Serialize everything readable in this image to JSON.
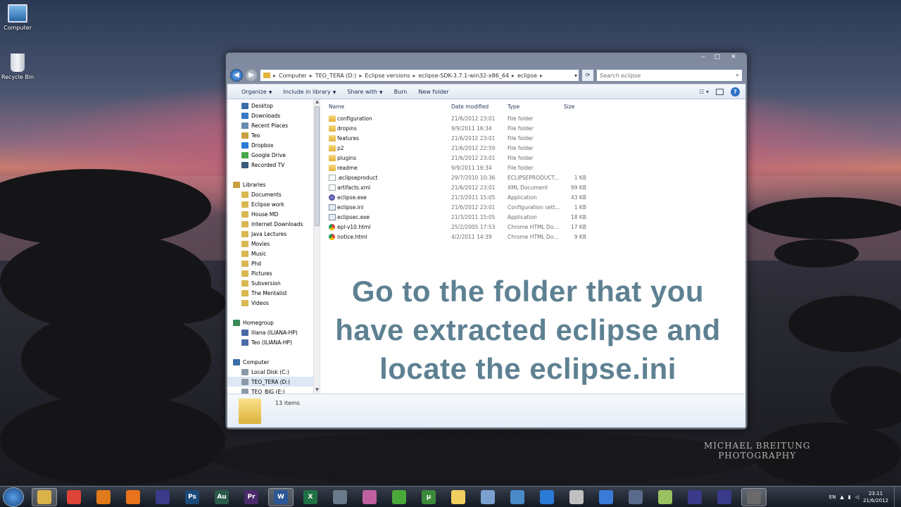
{
  "desktop": {
    "icons": [
      {
        "label": "Computer"
      },
      {
        "label": "Recycle Bin"
      }
    ],
    "watermark": [
      "MICHAEL BREITUNG",
      "PHOTOGRAPHY"
    ]
  },
  "window": {
    "address": {
      "crumbs": [
        "Computer",
        "TEO_TERA (D:)",
        "Eclipse versions",
        "eclipse-SDK-3.7.1-win32-x86_64",
        "eclipse"
      ]
    },
    "search": {
      "placeholder": "Search eclipse"
    },
    "toolbar": {
      "organize": "Organize",
      "include_in_library": "Include in library",
      "share_with": "Share with",
      "burn": "Burn",
      "new_folder": "New folder"
    },
    "nav": {
      "favorites": [
        "Desktop",
        "Downloads",
        "Recent Places",
        "Teo",
        "Dropbox",
        "Google Drive",
        "Recorded TV"
      ],
      "libraries_label": "Libraries",
      "libraries": [
        "Documents",
        "Eclipse work",
        "House MD",
        "Internet Downloads",
        "Java Lectures",
        "Movies",
        "Music",
        "Phd",
        "Pictures",
        "Subversion",
        "The Mentalist",
        "Videos"
      ],
      "homegroup_label": "Homegroup",
      "homegroup": [
        "Iliana (ILIANA-HP)",
        "Teo (ILIANA-HP)"
      ],
      "computer_label": "Computer",
      "drives": [
        "Local Disk (C:)",
        "TEO_TERA (D:)",
        "TEO_BIG (E:)"
      ]
    },
    "columns": {
      "name": "Name",
      "date": "Date modified",
      "type": "Type",
      "size": "Size"
    },
    "files": [
      {
        "name": "configuration",
        "date": "21/6/2012 23:01",
        "type": "File folder",
        "size": "",
        "icon": "folder"
      },
      {
        "name": "dropins",
        "date": "9/9/2011 16:34",
        "type": "File folder",
        "size": "",
        "icon": "folder"
      },
      {
        "name": "features",
        "date": "21/6/2012 23:01",
        "type": "File folder",
        "size": "",
        "icon": "folder"
      },
      {
        "name": "p2",
        "date": "21/6/2012 22:59",
        "type": "File folder",
        "size": "",
        "icon": "folder"
      },
      {
        "name": "plugins",
        "date": "21/6/2012 23:01",
        "type": "File folder",
        "size": "",
        "icon": "folder"
      },
      {
        "name": "readme",
        "date": "9/9/2011 16:34",
        "type": "File folder",
        "size": "",
        "icon": "folder"
      },
      {
        "name": ".eclipseproduct",
        "date": "29/7/2010 10:36",
        "type": "ECLIPSEPRODUCT...",
        "size": "1 KB",
        "icon": "doc"
      },
      {
        "name": "artifacts.xml",
        "date": "21/6/2012 23:01",
        "type": "XML Document",
        "size": "99 KB",
        "icon": "doc"
      },
      {
        "name": "eclipse.exe",
        "date": "21/3/2011 15:05",
        "type": "Application",
        "size": "43 KB",
        "icon": "exe"
      },
      {
        "name": "eclipse.ini",
        "date": "21/6/2012 23:01",
        "type": "Configuration sett...",
        "size": "1 KB",
        "icon": "ini"
      },
      {
        "name": "eclipsec.exe",
        "date": "21/3/2011 15:05",
        "type": "Application",
        "size": "18 KB",
        "icon": "ini"
      },
      {
        "name": "epl-v10.html",
        "date": "25/2/2005 17:53",
        "type": "Chrome HTML Do...",
        "size": "17 KB",
        "icon": "chrome"
      },
      {
        "name": "notice.html",
        "date": "4/2/2011 14:39",
        "type": "Chrome HTML Do...",
        "size": "9 KB",
        "icon": "chrome"
      }
    ],
    "status": {
      "count": "13 items"
    }
  },
  "caption": [
    "Go to the folder that you",
    "have extracted eclipse and",
    "locate the eclipse.ini"
  ],
  "taskbar": {
    "apps": [
      {
        "name": "explorer",
        "label": "",
        "color": "#d9b24a"
      },
      {
        "name": "chrome",
        "label": "",
        "color": "#db4437"
      },
      {
        "name": "media-player",
        "label": "",
        "color": "#e07a1a"
      },
      {
        "name": "firefox",
        "label": "",
        "color": "#e8731c"
      },
      {
        "name": "eclipse",
        "label": "",
        "color": "#3a3a8a"
      },
      {
        "name": "photoshop",
        "label": "Ps",
        "color": "#1b4a7a"
      },
      {
        "name": "audition",
        "label": "Au",
        "color": "#2a5a4a"
      },
      {
        "name": "premiere",
        "label": "Pr",
        "color": "#4a2a6a"
      },
      {
        "name": "word",
        "label": "W",
        "color": "#2b5797"
      },
      {
        "name": "excel",
        "label": "X",
        "color": "#1e7145"
      },
      {
        "name": "tool",
        "label": "",
        "color": "#6a7a8a"
      },
      {
        "name": "paint",
        "label": "",
        "color": "#c060a0"
      },
      {
        "name": "xbox",
        "label": "",
        "color": "#4aa83a"
      },
      {
        "name": "utorrent",
        "label": "µ",
        "color": "#3a8a3a"
      },
      {
        "name": "folder",
        "label": "",
        "color": "#f0d060"
      },
      {
        "name": "virtualbox",
        "label": "",
        "color": "#7aa0d0"
      },
      {
        "name": "screen",
        "label": "",
        "color": "#4a8ac8"
      },
      {
        "name": "dropbox",
        "label": "",
        "color": "#2a7ad8"
      },
      {
        "name": "chrome-2",
        "label": "",
        "color": "#c0c0c0"
      },
      {
        "name": "itunes",
        "label": "",
        "color": "#3a7ad8"
      },
      {
        "name": "network",
        "label": "",
        "color": "#5a6a8a"
      },
      {
        "name": "notes",
        "label": "",
        "color": "#9ac060"
      },
      {
        "name": "eclipse-2",
        "label": "",
        "color": "#3a3a8a"
      },
      {
        "name": "eclipse-3",
        "label": "",
        "color": "#3a3a8a"
      },
      {
        "name": "cmd",
        "label": "",
        "color": "#6a6a6a"
      }
    ],
    "active_indices": [
      0,
      8,
      24
    ],
    "lang": "EN",
    "time": "23:11",
    "date": "21/6/2012"
  }
}
